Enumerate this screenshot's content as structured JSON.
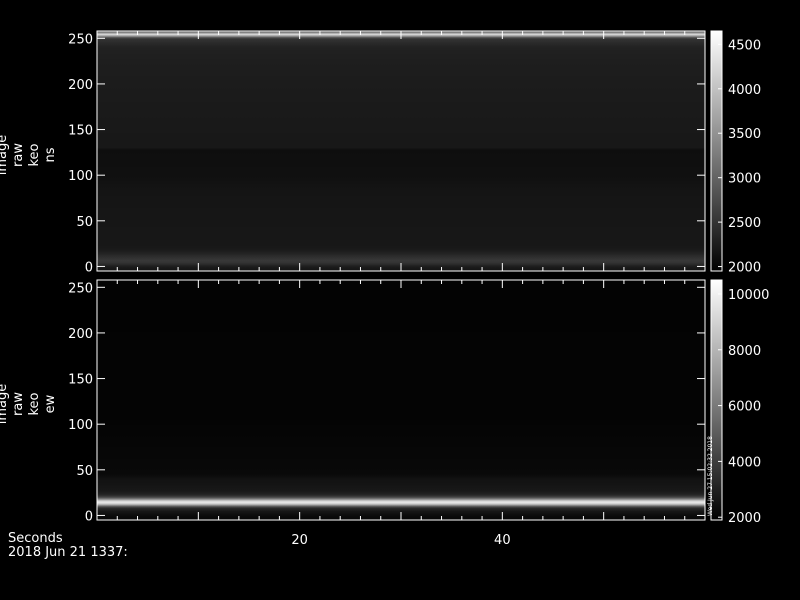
{
  "footer": {
    "xaxis_title": "Seconds",
    "date": "2018 Jun 21 1337:"
  },
  "chart_data": [
    {
      "type": "heatmap",
      "ylabel": [
        "image",
        "raw",
        "keo",
        "ns"
      ],
      "x_ticks": [
        20,
        40
      ],
      "xlim": [
        0,
        60
      ],
      "y_ticks": [
        0,
        50,
        100,
        150,
        200,
        250
      ],
      "ylim": [
        -5,
        258
      ],
      "colorbar": {
        "ticks": [
          2000,
          2500,
          3000,
          3500,
          4000,
          4500
        ],
        "range": [
          1950,
          4650
        ]
      },
      "row_profile": [
        {
          "y": -5,
          "value": 2150
        },
        {
          "y": 0,
          "value": 2250
        },
        {
          "y": 3,
          "value": 2450
        },
        {
          "y": 6,
          "value": 2550
        },
        {
          "y": 10,
          "value": 2450
        },
        {
          "y": 15,
          "value": 2300
        },
        {
          "y": 20,
          "value": 2200
        },
        {
          "y": 60,
          "value": 2180
        },
        {
          "y": 85,
          "value": 2160
        },
        {
          "y": 100,
          "value": 2120
        },
        {
          "y": 128,
          "value": 2100
        },
        {
          "y": 130,
          "value": 2200
        },
        {
          "y": 180,
          "value": 2230
        },
        {
          "y": 220,
          "value": 2260
        },
        {
          "y": 240,
          "value": 2300
        },
        {
          "y": 250,
          "value": 2500
        },
        {
          "y": 253,
          "value": 3800
        },
        {
          "y": 255,
          "value": 4600
        },
        {
          "y": 256,
          "value": 3500
        },
        {
          "y": 258,
          "value": 2600
        }
      ]
    },
    {
      "type": "heatmap",
      "ylabel": [
        "image",
        "raw",
        "keo",
        "ew"
      ],
      "x_ticks": [
        20,
        40
      ],
      "xlim": [
        0,
        60
      ],
      "y_ticks": [
        0,
        50,
        100,
        150,
        200,
        250
      ],
      "ylim": [
        -5,
        258
      ],
      "colorbar": {
        "ticks": [
          2000,
          4000,
          6000,
          8000,
          10000
        ],
        "range": [
          1900,
          10500
        ],
        "annotation": "Wed Jun 27 15:02:32 2018"
      },
      "row_profile": [
        {
          "y": -5,
          "value": 2100
        },
        {
          "y": 0,
          "value": 2300
        },
        {
          "y": 5,
          "value": 2700
        },
        {
          "y": 9,
          "value": 3600
        },
        {
          "y": 11,
          "value": 6500
        },
        {
          "y": 13,
          "value": 9500
        },
        {
          "y": 15,
          "value": 10000
        },
        {
          "y": 17,
          "value": 7500
        },
        {
          "y": 19,
          "value": 5000
        },
        {
          "y": 22,
          "value": 3200
        },
        {
          "y": 27,
          "value": 2700
        },
        {
          "y": 40,
          "value": 2500
        },
        {
          "y": 45,
          "value": 2200
        },
        {
          "y": 100,
          "value": 2050
        },
        {
          "y": 258,
          "value": 2000
        }
      ]
    }
  ]
}
